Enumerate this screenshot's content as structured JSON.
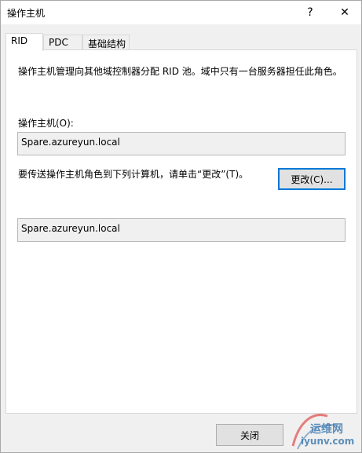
{
  "window": {
    "title": "操作主机",
    "help_glyph": "?",
    "close_glyph": "✕"
  },
  "tabs": [
    {
      "label": "RID",
      "active": true
    },
    {
      "label": "PDC",
      "active": false
    },
    {
      "label": "基础结构",
      "active": false
    }
  ],
  "rid": {
    "description": "操作主机管理向其他域控制器分配 RID 池。域中只有一台服务器担任此角色。",
    "operations_master_label": "操作主机(O):",
    "operations_master_value": "Spare.azureyun.local",
    "transfer_text": "要传送操作主机角色到下列计算机，请单击“更改”(T)。",
    "change_button_label": "更改(C)...",
    "target_computer_value": "Spare.azureyun.local"
  },
  "footer": {
    "close_button_label": "关闭"
  },
  "watermark": {
    "top": "运维网",
    "bottom": "iyunv.com"
  },
  "colors": {
    "accent": "#0078d7",
    "watermark": "#2d6ea8"
  }
}
